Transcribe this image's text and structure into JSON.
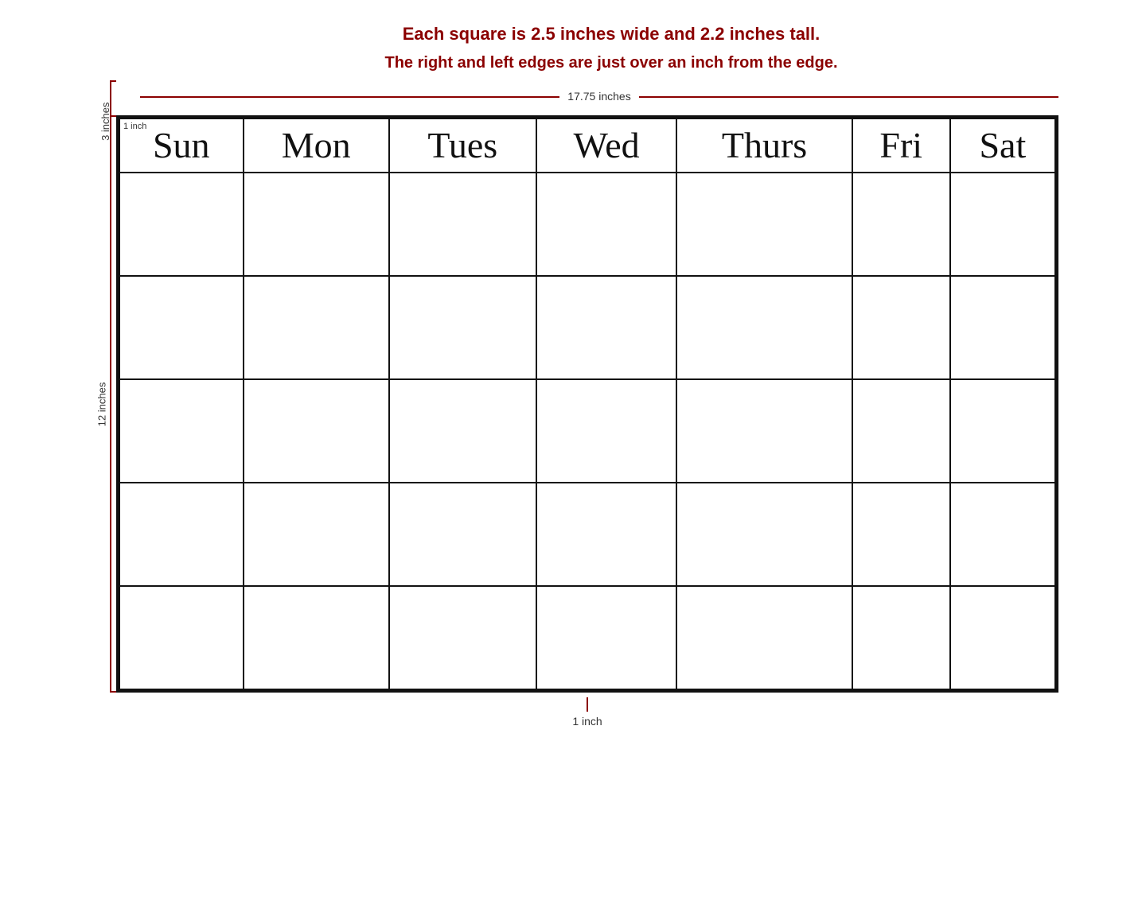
{
  "info": {
    "line1": "Each square is 2.5 inches wide and 2.2 inches tall.",
    "line2": "The right and left edges are just over an inch from the edge."
  },
  "dimensions": {
    "horizontal_label": "17.75 inches",
    "vertical_main_label": "12 inches",
    "vertical_top_label": "3 inches",
    "bottom_label": "1 inch",
    "corner_label": "1 inch"
  },
  "days": [
    "Sun",
    "Mon",
    "Tues",
    "Wed",
    "Thurs",
    "Fri",
    "Sat"
  ],
  "rows": 5
}
